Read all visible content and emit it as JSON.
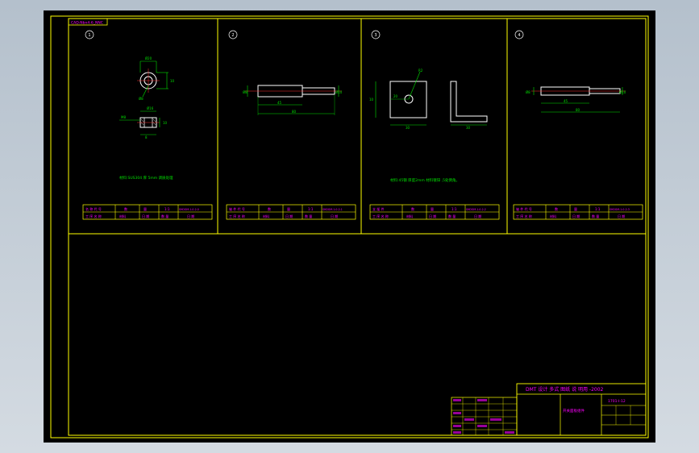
{
  "drawing": {
    "corner_tag": "CAD-Nbn4-6_NNC",
    "title_block": {
      "heading": "DMT 设计  多式 图纸 说 明用 -2002",
      "part_name": "开关面板组件",
      "drawing_no": "1701-I-12"
    }
  },
  "sheets": [
    {
      "label": "1",
      "note": "材料:SUS304 厚 5mm 调质处理",
      "row1": [
        "名 称 代 号",
        "数",
        "量",
        "1:1",
        "SHDGM-1-0-2-0"
      ],
      "row2": [
        "工 序 名 称",
        "材料",
        "日 期",
        "数 量",
        "日  期"
      ]
    },
    {
      "label": "2",
      "note": "",
      "row1": [
        "轴 件 代 号",
        "数",
        "量",
        "1:1",
        "SHDGM-1-0-2-1"
      ],
      "row2": [
        "工 序 名 称",
        "材料",
        "日 期",
        "数 量",
        "日  期"
      ]
    },
    {
      "label": "3",
      "note": "材料:45钢 厚度2mm 材料镀锌 ,5处倒角。",
      "row1": [
        "支 架 件",
        "数",
        "量",
        "1:1",
        "SHDGM-1-0-2-2"
      ],
      "row2": [
        "工 序 名 称",
        "材料",
        "日 期",
        "数 量",
        "日  期"
      ]
    },
    {
      "label": "4",
      "note": "",
      "row1": [
        "轴 件 代 号",
        "数",
        "量",
        "1:1",
        "SHDGM-1-0-2-3"
      ],
      "row2": [
        "工 序 名 称",
        "材料",
        "日 期",
        "数 量",
        "日  期"
      ]
    }
  ],
  "dimensions": {
    "s1": [
      "Ø20",
      "Ø8",
      "10",
      "Ø16",
      "M8",
      "10",
      "8"
    ],
    "s2": [
      "Ø8",
      "Ø10",
      "45",
      "80"
    ],
    "s3": [
      "R2",
      "10",
      "20",
      "30",
      "20",
      "30"
    ],
    "s4": [
      "Ø8",
      "Ø10",
      "45",
      "80"
    ]
  },
  "colors": {
    "frame": "#ffff00",
    "green": "#00e000",
    "magenta": "#ff00ff",
    "white": "#ffffff",
    "cyan": "#00ffff"
  }
}
